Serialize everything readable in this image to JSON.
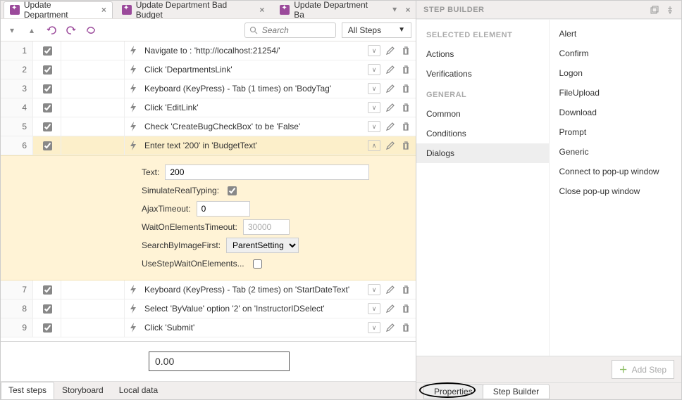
{
  "tabs": [
    {
      "label": "Update Department",
      "active": true
    },
    {
      "label": "Update Department Bad Budget",
      "active": false
    },
    {
      "label": "Update Department Ba",
      "active": false
    }
  ],
  "search": {
    "placeholder": "Search"
  },
  "steps_filter": "All Steps",
  "steps": [
    {
      "n": 1,
      "label": "Navigate to : 'http://localhost:21254/'"
    },
    {
      "n": 2,
      "label": "Click 'DepartmentsLink'"
    },
    {
      "n": 3,
      "label": "Keyboard (KeyPress) - Tab (1 times) on 'BodyTag'"
    },
    {
      "n": 4,
      "label": "Click 'EditLink'"
    },
    {
      "n": 5,
      "label": "Check 'CreateBugCheckBox' to be 'False'"
    },
    {
      "n": 6,
      "label": "Enter text '200' in 'BudgetText'",
      "selected": true
    },
    {
      "n": 7,
      "label": "Keyboard (KeyPress) - Tab (2 times) on 'StartDateText'"
    },
    {
      "n": 8,
      "label": "Select 'ByValue' option '2' on 'InstructorIDSelect'"
    },
    {
      "n": 9,
      "label": "Click 'Submit'"
    }
  ],
  "expand": {
    "text_label": "Text:",
    "text_value": "200",
    "srt_label": "SimulateRealTyping:",
    "srt_value": true,
    "ajax_label": "AjaxTimeout:",
    "ajax_value": "0",
    "woe_label": "WaitOnElementsTimeout:",
    "woe_value": "30000",
    "sbi_label": "SearchByImageFirst:",
    "sbi_value": "ParentSetting",
    "uswoe_label": "UseStepWaitOnElements..."
  },
  "value_box": "0.00",
  "bottom_tabs": [
    "Test steps",
    "Storyboard",
    "Local data"
  ],
  "right": {
    "title": "STEP BUILDER",
    "left_groups": [
      {
        "heading": "SELECTED ELEMENT",
        "items": [
          "Actions",
          "Verifications"
        ]
      },
      {
        "heading": "GENERAL",
        "items": [
          "Common",
          "Conditions",
          "Dialogs"
        ]
      }
    ],
    "right_items": [
      "Alert",
      "Confirm",
      "Logon",
      "FileUpload",
      "Download",
      "Prompt",
      "Generic",
      "Connect to pop-up window",
      "Close pop-up window"
    ],
    "selected_left": "Dialogs",
    "add_step": "Add Step",
    "tabs": [
      "Properties",
      "Step Builder"
    ],
    "active_tab": "Step Builder"
  }
}
